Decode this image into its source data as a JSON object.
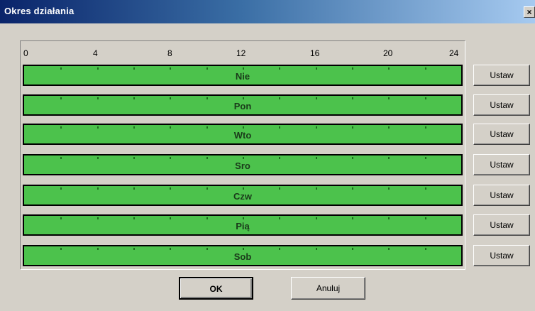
{
  "window": {
    "title": "Okres działania",
    "close_glyph": "×"
  },
  "axis": {
    "ticks": [
      "0",
      "4",
      "8",
      "12",
      "16",
      "20",
      "24"
    ]
  },
  "days": [
    {
      "label": "Nie",
      "set_label": "Ustaw"
    },
    {
      "label": "Pon",
      "set_label": "Ustaw"
    },
    {
      "label": "Wto",
      "set_label": "Ustaw"
    },
    {
      "label": "Sro",
      "set_label": "Ustaw"
    },
    {
      "label": "Czw",
      "set_label": "Ustaw"
    },
    {
      "label": "Pią",
      "set_label": "Ustaw"
    },
    {
      "label": "Sob",
      "set_label": "Ustaw"
    }
  ],
  "footer": {
    "ok_label": "OK",
    "cancel_label": "Anuluj"
  },
  "colors": {
    "bar_fill": "#4cc24c",
    "title_start": "#0a246a",
    "dialog_bg": "#d4d0c8"
  }
}
